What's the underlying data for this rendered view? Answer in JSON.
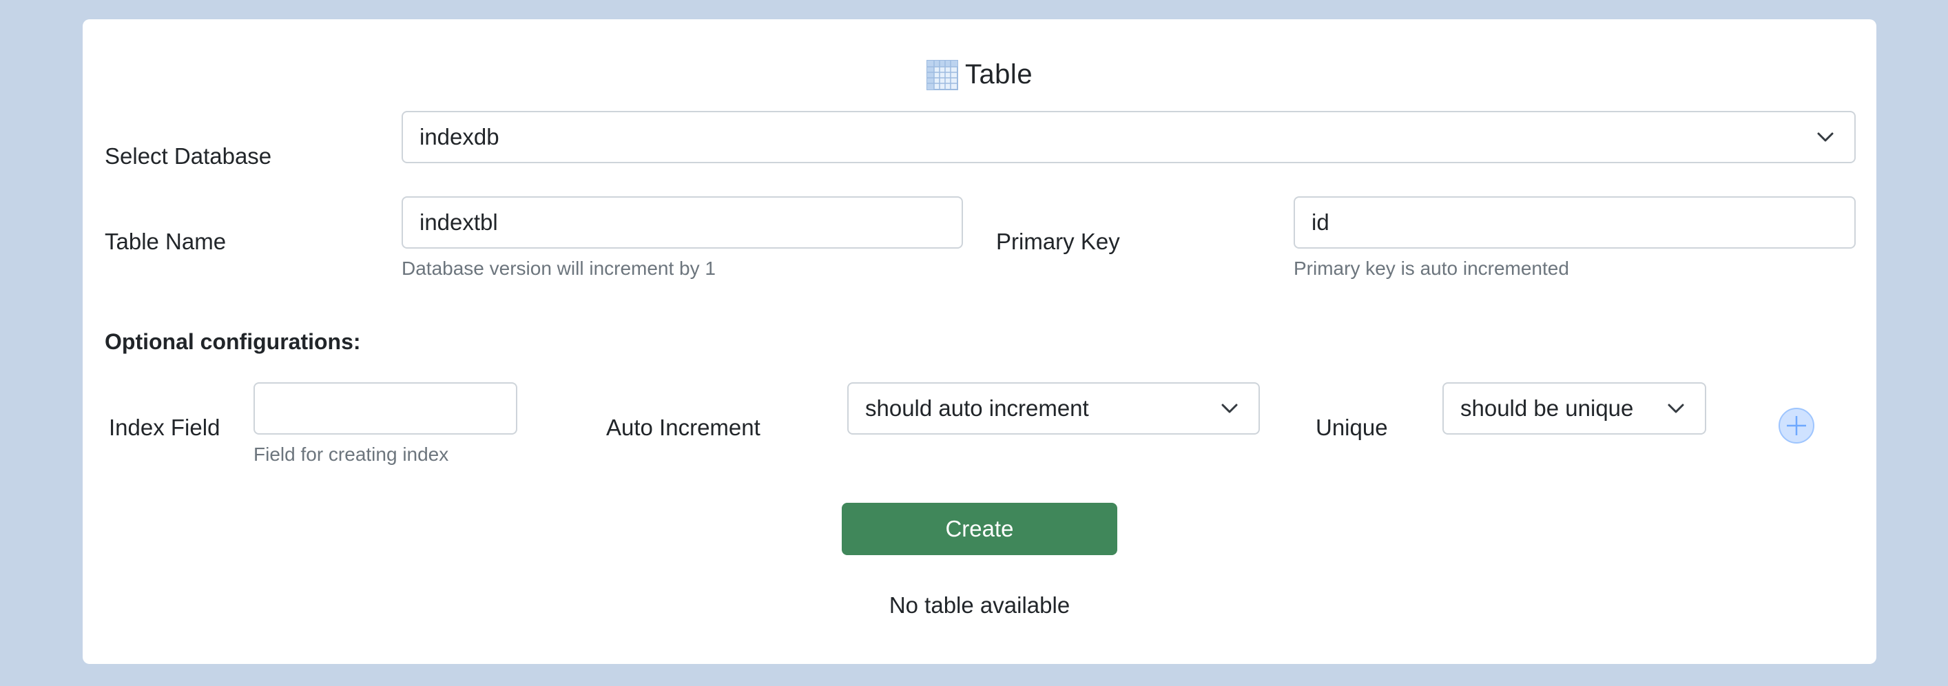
{
  "header": {
    "title": "Table",
    "icon": "table-icon"
  },
  "database": {
    "label": "Select Database",
    "selected": "indexdb"
  },
  "table_name": {
    "label": "Table Name",
    "value": "indextbl",
    "help": "Database version will increment by 1"
  },
  "primary_key": {
    "label": "Primary Key",
    "value": "id",
    "help": "Primary key is auto incremented"
  },
  "optional": {
    "heading": "Optional configurations:",
    "index_field": {
      "label": "Index Field",
      "value": "",
      "help": "Field for creating index"
    },
    "auto_increment": {
      "label": "Auto Increment",
      "selected": "should auto increment"
    },
    "unique": {
      "label": "Unique",
      "selected": "should be unique"
    },
    "add_icon": "plus-circle-icon"
  },
  "actions": {
    "create_label": "Create"
  },
  "status": {
    "empty_message": "No table available"
  },
  "colors": {
    "background": "#c5d4e7",
    "primary_button": "#40875a",
    "add_icon": "#9ec5fe"
  }
}
